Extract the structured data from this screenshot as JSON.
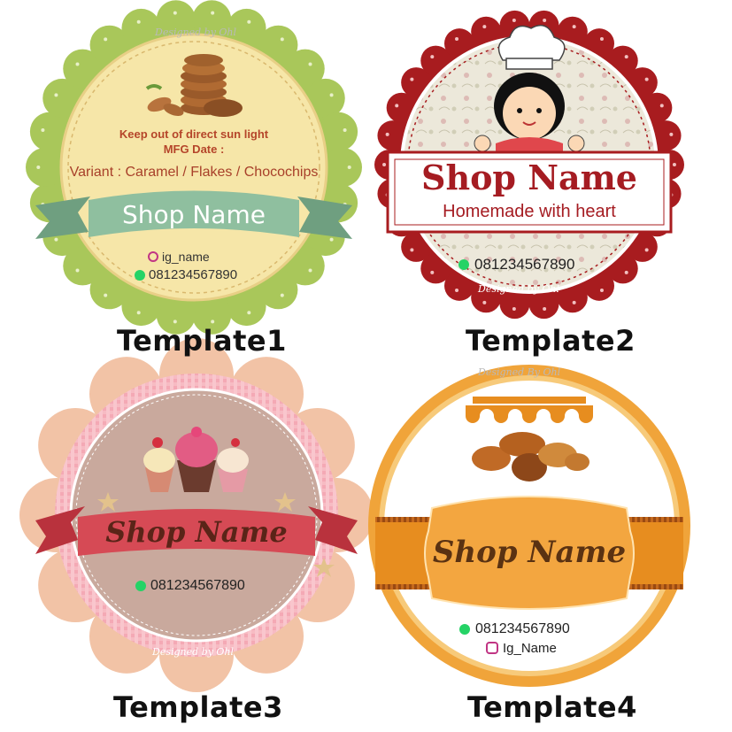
{
  "templates": [
    {
      "caption": "Template1",
      "watermark": "Designed by Ohl",
      "line1": "Keep out of direct sun light",
      "line2": "MFG Date :",
      "variant": "Variant : Caramel / Flakes / Chocochips",
      "shop_name": "Shop Name",
      "ig": "ig_name",
      "phone": "081234567890"
    },
    {
      "caption": "Template2",
      "watermark": "Designed by Ohl",
      "shop_name": "Shop Name",
      "tagline": "Homemade with heart",
      "phone": "081234567890"
    },
    {
      "caption": "Template3",
      "watermark": "Designed by Ohl",
      "shop_name": "Shop Name",
      "phone": "081234567890"
    },
    {
      "caption": "Template4",
      "watermark": "Designed By Ohl",
      "shop_name": "Shop Name",
      "phone": "081234567890",
      "ig": "Ig_Name"
    }
  ],
  "colors": {
    "t1_scallop": "#a9c75a",
    "t1_face": "#f6e6a8",
    "t1_ribbon": "#8fbf9f",
    "t2_scallop": "#a81c1f",
    "t2_face": "#ece8da",
    "t2_text": "#a51c22",
    "t3_scallop": "#f2c3a6",
    "t3_ribbon": "#d64a55",
    "t4_rim": "#f0a43a",
    "t4_band": "#e78d1f"
  }
}
